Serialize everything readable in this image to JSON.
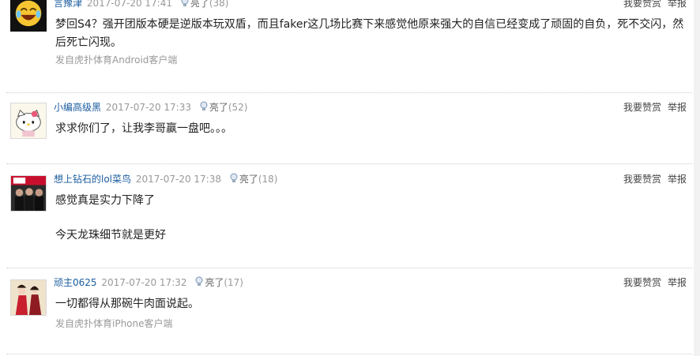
{
  "comments": [
    {
      "username": "言豫津",
      "time": "2017-07-20 17:41",
      "light_label": "亮了",
      "light_count": "(38)",
      "paragraphs": [
        "梦回S4？强开团版本硬是逆版本玩双盾，而且faker这几场比赛下来感觉他原来强大的自信已经变成了顽固的自负，死不交闪，然后死亡闪现。"
      ],
      "source": "发自虎扑体育Android客户端"
    },
    {
      "username": "小编高级黑",
      "time": "2017-07-20 17:33",
      "light_label": "亮了",
      "light_count": "(52)",
      "paragraphs": [
        "求求你们了，让我李哥赢一盘吧。。。"
      ],
      "source": ""
    },
    {
      "username": "想上钻石的lol菜鸟",
      "time": "2017-07-20 17:38",
      "light_label": "亮了",
      "light_count": "(18)",
      "paragraphs": [
        "感觉真是实力下降了",
        "今天龙珠细节就是更好"
      ],
      "source": ""
    },
    {
      "username": "顽主0625",
      "time": "2017-07-20 17:32",
      "light_label": "亮了",
      "light_count": "(17)",
      "paragraphs": [
        "一切都得从那碗牛肉面说起。"
      ],
      "source": "发自虎扑体育iPhone客户端"
    }
  ],
  "actions": {
    "reward": "我要赞赏",
    "report": "举报"
  },
  "avatars": [
    "laughing-emoji-avatar",
    "hello-kitty-avatar",
    "lpl-team-photo-avatar",
    "painting-figures-avatar"
  ],
  "colors": {
    "username": "#1a5b9e",
    "meta": "#999999",
    "text": "#222222"
  }
}
